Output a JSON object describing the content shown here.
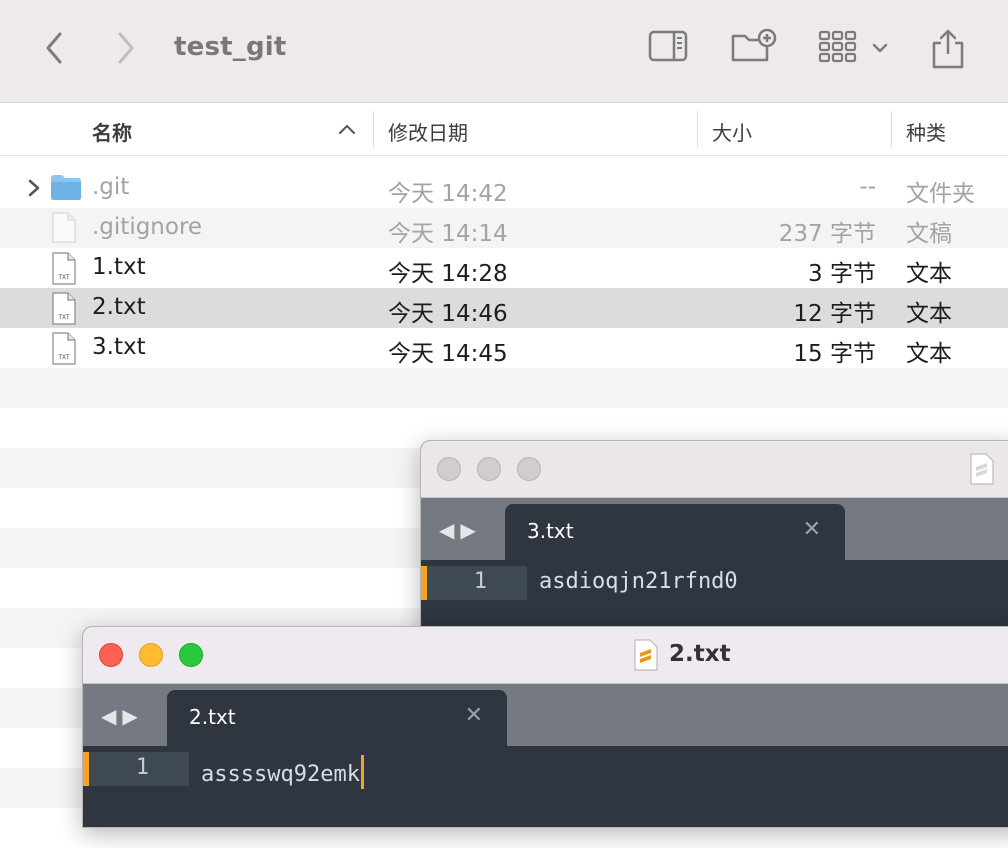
{
  "finder": {
    "title": "test_git",
    "columns": {
      "name": "名称",
      "date": "修改日期",
      "size": "大小",
      "kind": "种类"
    },
    "rows": [
      {
        "name": ".git",
        "date": "今天 14:42",
        "size": "--",
        "kind": "文件夹",
        "icon": "folder-icon"
      },
      {
        "name": ".gitignore",
        "date": "今天 14:14",
        "size": "237 字节",
        "kind": "文稿",
        "icon": "document-icon"
      },
      {
        "name": "1.txt",
        "date": "今天 14:28",
        "size": "3 字节",
        "kind": "文本",
        "icon": "txt-file-icon"
      },
      {
        "name": "2.txt",
        "date": "今天 14:46",
        "size": "12 字节",
        "kind": "文本",
        "icon": "txt-file-icon"
      },
      {
        "name": "3.txt",
        "date": "今天 14:45",
        "size": "15 字节",
        "kind": "文本",
        "icon": "txt-file-icon"
      }
    ],
    "icon_label": "TXT"
  },
  "editor_back": {
    "tab_label": "3.txt",
    "line_number": "1",
    "code": "asdioqjn21rfnd0"
  },
  "editor_front": {
    "title": "2.txt",
    "tab_label": "2.txt",
    "line_number": "1",
    "code": "asssswq92emk"
  },
  "common": {
    "tab_nav": "◀▶",
    "close_glyph": "✕"
  },
  "colors": {
    "caret": "#f6a223",
    "editor_bg": "#2f3640",
    "selected_row": "#dcdcdc"
  }
}
